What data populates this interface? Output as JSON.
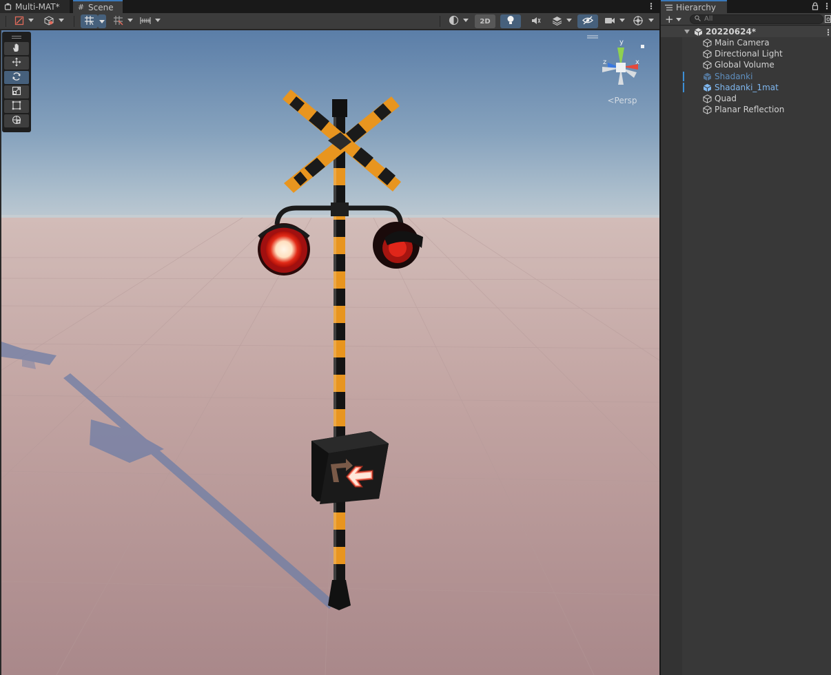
{
  "scene_tabs": [
    {
      "label": "Multi-MAT*",
      "icon": "unity-scene-icon",
      "active": false
    },
    {
      "label": "Scene",
      "icon": "grid-hash-icon",
      "active": true
    }
  ],
  "scene_toolbar": {
    "view_2d_label": "2D"
  },
  "tools": [
    {
      "name": "hand-tool",
      "icon": "hand-icon"
    },
    {
      "name": "move-tool",
      "icon": "move-arrows-icon"
    },
    {
      "name": "rotate-tool",
      "icon": "rotate-icon",
      "selected": true
    },
    {
      "name": "scale-tool",
      "icon": "scale-icon"
    },
    {
      "name": "rect-tool",
      "icon": "rect-transform-icon"
    },
    {
      "name": "transform-tool",
      "icon": "transform-icon"
    }
  ],
  "gizmo": {
    "x_label": "x",
    "y_label": "y",
    "z_label": "z",
    "projection_label": "Persp"
  },
  "hierarchy": {
    "tab_label": "Hierarchy",
    "search_placeholder": "All",
    "scene_name": "20220624*",
    "items": [
      {
        "label": "Main Camera",
        "type": "gameobject"
      },
      {
        "label": "Directional Light",
        "type": "gameobject"
      },
      {
        "label": "Global Volume",
        "type": "gameobject"
      },
      {
        "label": "Shadanki",
        "type": "prefab-inactive"
      },
      {
        "label": "Shadanki_1mat",
        "type": "prefab"
      },
      {
        "label": "Quad",
        "type": "gameobject"
      },
      {
        "label": "Planar Reflection",
        "type": "gameobject"
      }
    ]
  },
  "colors": {
    "accent": "#3a79bb",
    "selected_tool": "#46607c",
    "prefab_text": "#7fb7ef",
    "sky_top": "#5b7ea8",
    "horizon": "#b7c4cf",
    "ground": "#c6a8a6",
    "pole_orange": "#e8951f",
    "lamp_red": "#d01a10"
  }
}
